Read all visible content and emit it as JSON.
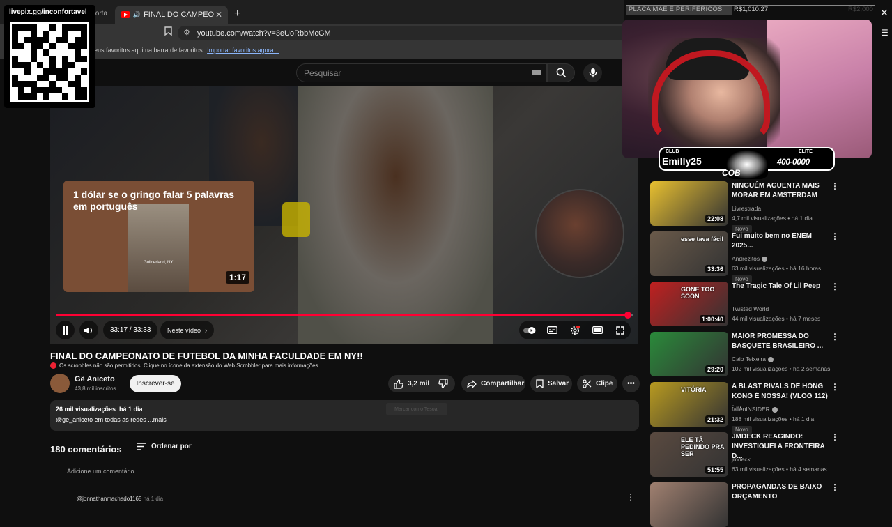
{
  "browser": {
    "prev_tab_label": "forta",
    "active_tab_label": "FINAL DO CAMPEONATO DE",
    "url": "youtube.com/watch?v=3eUoRbbMcGM",
    "bookmarks_hint": "eus favoritos aqui na barra de favoritos.",
    "bookmarks_link": "Importar favoritos agora..."
  },
  "overlay": {
    "qr_url": "livepix.gg/inconfortavel",
    "donation_label": "PLACA MÃE E PERIFÉRICOS",
    "donation_value": "R$1,010.27",
    "donation_goal": "R$2,000",
    "nameplate_small_left": "CLUB",
    "nameplate_name": "Emilly25",
    "nameplate_small_right": "ELITE",
    "nameplate_rank": "400-0000",
    "nameplate_sub": "COB"
  },
  "search": {
    "placeholder": "Pesquisar"
  },
  "player": {
    "endcard_title": "1 dólar se o gringo falar 5 palavras em português",
    "endcard_duration": "1:17",
    "endcard_location": "Guilderland, NY",
    "time": "33:17 / 33:33",
    "chapter": "Neste vídeo",
    "progress": 0.992,
    "colors": {
      "progress": "#ff0033"
    }
  },
  "video": {
    "title": "FINAL DO CAMPEONATO DE FUTEBOL DA MINHA FACULDADE EM NY!!",
    "scrobbler_notice": "Os scrobbles não são permitidos. Clique no ícone da extensão do Web Scrobbler para mais informações.",
    "channel": "Gê Aniceto",
    "subscribers": "43,8 mil inscritos",
    "subscribe_label": "Inscrever-se",
    "likes": "3,2 mil",
    "share_label": "Compartilhar",
    "save_label": "Salvar",
    "clip_label": "Clipe",
    "views_date": "26 mil visualizações  há 1 dia",
    "description": "@ge_aniceto em todas as redes ...mais",
    "ghost_text": "Marcar como Tesoar"
  },
  "comments": {
    "count": "180 comentários",
    "sort_label": "Ordenar por",
    "add_placeholder": "Adicione um comentário...",
    "first_author": "@jonnathanmachado1165",
    "first_time": "há 1 dia"
  },
  "recommendations": [
    {
      "title": "NINGUÉM AGUENTA MAIS MORAR EM AMSTERDAM",
      "channel": "Livrestrada",
      "verified": false,
      "meta": "4,7 mil visualizações • há 1 dia",
      "duration": "22:08",
      "badge": "Novo",
      "thumb": "#e8c030",
      "overlay": ""
    },
    {
      "title": "Fui muito bem no ENEM 2025...",
      "channel": "Andrezitos",
      "verified": true,
      "meta": "63 mil visualizações • há 16 horas",
      "duration": "33:36",
      "badge": "Novo",
      "thumb": "#6a5a4a",
      "overlay": "esse tava fácil"
    },
    {
      "title": "The Tragic Tale Of Lil Peep",
      "channel": "Twisted World",
      "verified": false,
      "meta": "44 mil visualizações • há 7 meses",
      "duration": "1:00:40",
      "badge": "",
      "thumb": "#c02020",
      "overlay": "GONE TOO SOON"
    },
    {
      "title": "MAIOR PROMESSA DO BASQUETE BRASILEIRO ...",
      "channel": "Caio Teixeira",
      "verified": true,
      "meta": "102 mil visualizações • há 2 semanas",
      "duration": "29:20",
      "badge": "",
      "thumb": "#2a8a3a",
      "overlay": ""
    },
    {
      "title": "A BLAST RIVALS DE HONG KONG É NOSSA! (VLOG 112) - ...",
      "channel": "fallenINSIDER",
      "verified": true,
      "meta": "188 mil visualizações • há 1 dia",
      "duration": "21:32",
      "badge": "Novo",
      "thumb": "#b89a20",
      "overlay": "VITÓRIA"
    },
    {
      "title": "JMDECK REAGINDO: INVESTIGUEI A FRONTEIRA D...",
      "channel": "jmdeck",
      "verified": false,
      "meta": "63 mil visualizações • há 4 semanas",
      "duration": "51:55",
      "badge": "",
      "thumb": "#5a4a40",
      "overlay": "ELE TÁ PEDINDO PRA SER"
    },
    {
      "title": "PROPAGANDAS DE BAIXO ORÇAMENTO",
      "channel": "",
      "verified": false,
      "meta": "",
      "duration": "",
      "badge": "",
      "thumb": "#a08070",
      "overlay": ""
    }
  ]
}
